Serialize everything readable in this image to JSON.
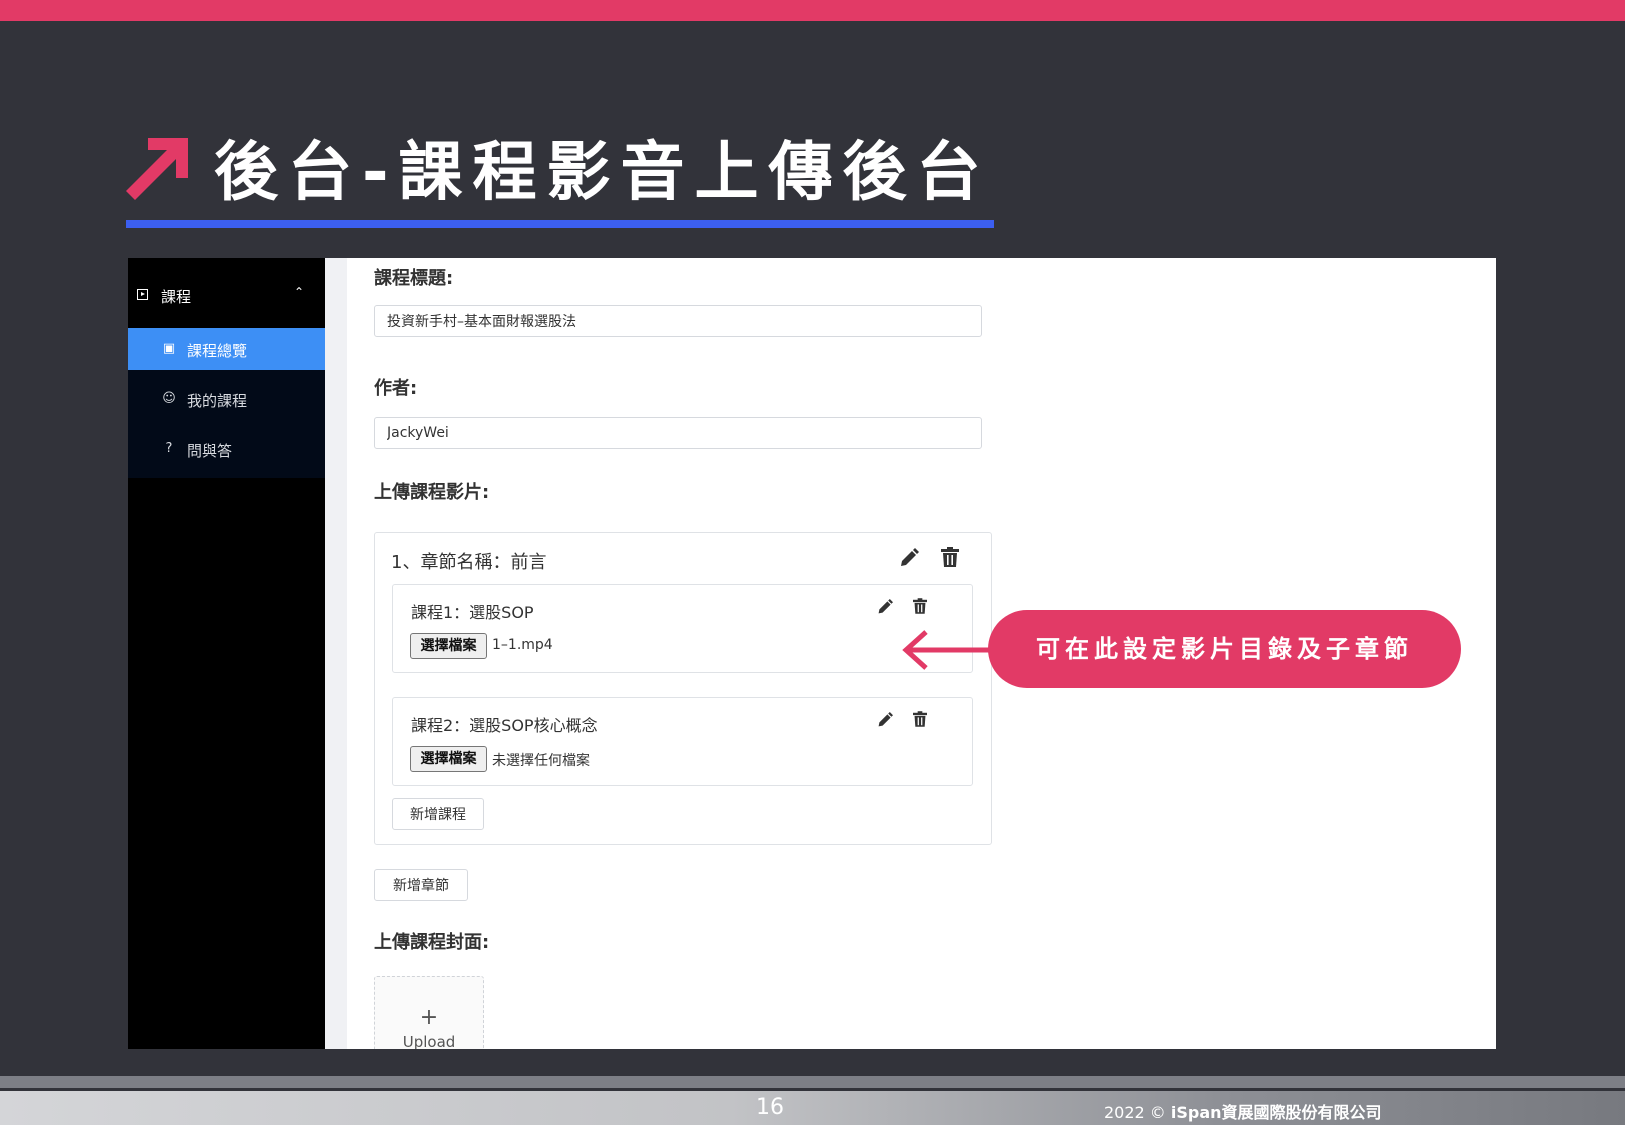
{
  "slide": {
    "title": "後台-課程影音上傳後台",
    "page_number": "16",
    "copyright_prefix": "2022 ©",
    "copyright_company": "iSpan資展國際股份有限公司",
    "accent_color": "#e23a66",
    "underline_color": "#3c5ff0"
  },
  "sidebar": {
    "group_label": "課程",
    "group_icon": "play-square-icon",
    "items": [
      {
        "label": "課程總覽",
        "icon": "calendar-icon",
        "active": true
      },
      {
        "label": "我的課程",
        "icon": "smile-icon",
        "active": false
      },
      {
        "label": "問與答",
        "icon": "question-icon",
        "active": false
      }
    ]
  },
  "form": {
    "course_title_label": "課程標題:",
    "course_title_value": "投資新手村–基本面財報選股法",
    "author_label": "作者:",
    "author_value": "JackyWei",
    "upload_videos_label": "上傳課程影片:",
    "chapter": {
      "title": "1、章節名稱：前言",
      "lessons": [
        {
          "title": "課程1：選股SOP",
          "file_button": "選擇檔案",
          "file_name": "1–1.mp4"
        },
        {
          "title": "課程2：選股SOP核心概念",
          "file_button": "選擇檔案",
          "file_name": "未選擇任何檔案"
        }
      ],
      "add_lesson_label": "新增課程"
    },
    "add_chapter_label": "新增章節",
    "upload_cover_label": "上傳課程封面:",
    "upload_plus": "+",
    "upload_text": "Upload"
  },
  "callout": {
    "text": "可在此設定影片目錄及子章節"
  }
}
